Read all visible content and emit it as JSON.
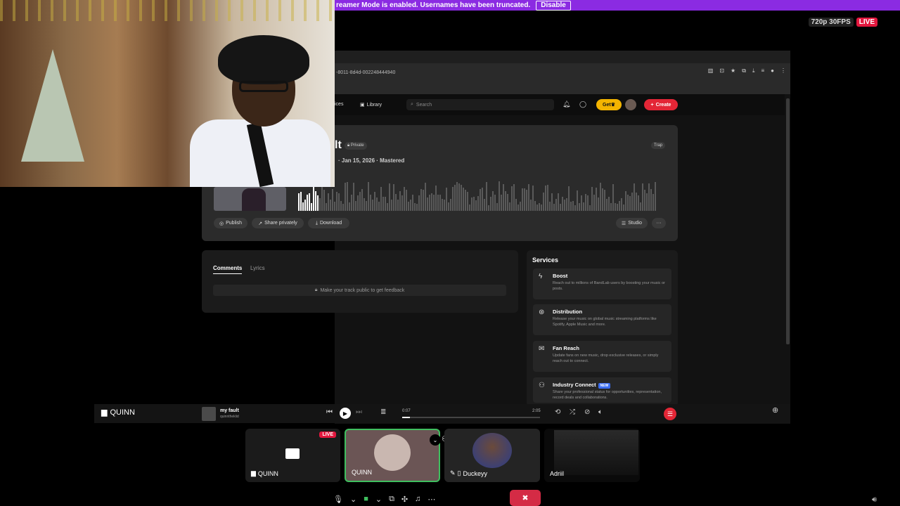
{
  "banner": {
    "text": "reamer Mode is enabled. Usernames have been truncated.",
    "disable_label": "Disable"
  },
  "stream": {
    "quality": "720p 30FPS",
    "live": "LIVE"
  },
  "browser": {
    "url": "-8011-8d4d-002248444940"
  },
  "app": {
    "nav": {
      "partial_item": "ices",
      "library": "Library",
      "search_placeholder": "Search",
      "get_label": "Get",
      "create_label": "Create"
    },
    "track": {
      "title_fragment": "lt",
      "privacy": "Private",
      "genre": "Trap",
      "meta": "· Jan 15, 2026 · Mastered"
    },
    "actions": {
      "publish": "Publish",
      "share": "Share privately",
      "download": "Download",
      "studio": "Studio",
      "more": "···"
    },
    "tabs": {
      "comments": "Comments",
      "lyrics": "Lyrics"
    },
    "feedback": "Make your track public to get feedback",
    "services": {
      "title": "Services",
      "items": [
        {
          "icon": "bolt-icon",
          "title": "Boost",
          "desc": "Reach out to millions of BandLab users by boosting your music or posts."
        },
        {
          "icon": "distribution-icon",
          "title": "Distribution",
          "desc": "Release your music on global music streaming platforms like Spotify, Apple Music and more."
        },
        {
          "icon": "mail-icon",
          "title": "Fan Reach",
          "desc": "Update fans on new music, drop exclusive releases, or simply reach out to connect."
        },
        {
          "icon": "people-icon",
          "title": "Industry Connect",
          "badge": "NEW",
          "desc": "Share your professional status for opportunities, representation, record deals and collaborations."
        }
      ]
    }
  },
  "player": {
    "label": "QUINN",
    "title": "my fault",
    "artist": "quinntheklid",
    "elapsed": "0:07",
    "total": "2:05",
    "progress": 0.056
  },
  "tiles": [
    {
      "name": "QUINN",
      "live": "LIVE"
    },
    {
      "name": "QUINN"
    },
    {
      "name": "Duckeyy"
    },
    {
      "name": "Adriil"
    }
  ]
}
